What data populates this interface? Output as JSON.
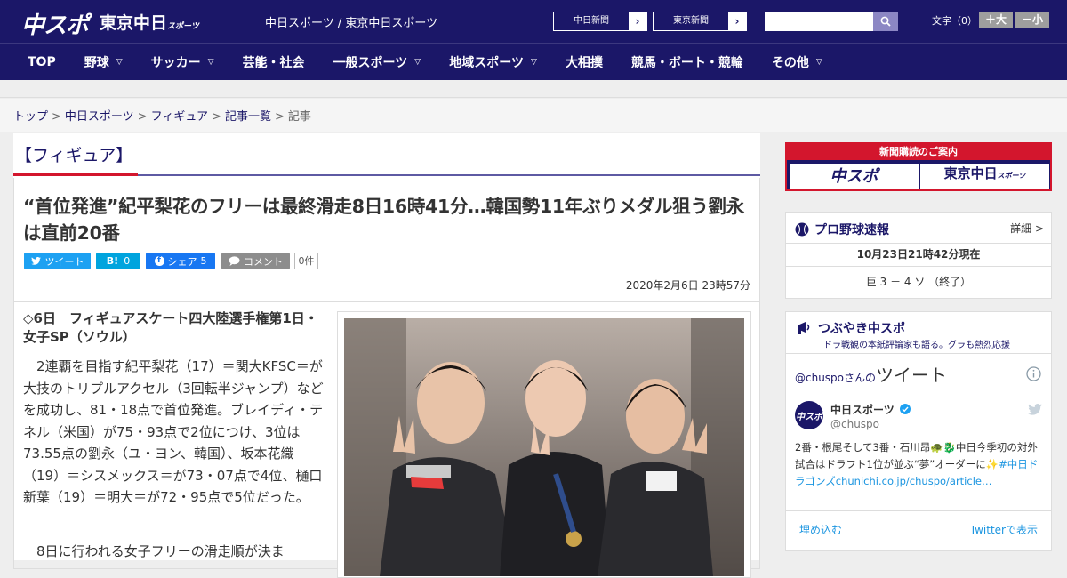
{
  "header": {
    "logo_main": "中スポ",
    "logo_tokyo": "東京中日",
    "logo_tokyo_sub": "スポーツ",
    "site_names": "中日スポーツ / 東京中日スポーツ",
    "paper_links": [
      "中日新聞",
      "東京新聞"
    ],
    "search": {
      "placeholder": ""
    },
    "font_size_label": "文字（0）",
    "font_bigger": "＋大",
    "font_smaller": "－小"
  },
  "nav": {
    "items": [
      {
        "label": "TOP",
        "has_menu": false
      },
      {
        "label": "野球",
        "has_menu": true
      },
      {
        "label": "サッカー",
        "has_menu": true
      },
      {
        "label": "芸能・社会",
        "has_menu": false
      },
      {
        "label": "一般スポーツ",
        "has_menu": true
      },
      {
        "label": "地域スポーツ",
        "has_menu": true
      },
      {
        "label": "大相撲",
        "has_menu": false
      },
      {
        "label": "競馬・ボート・競輪",
        "has_menu": false
      },
      {
        "label": "その他",
        "has_menu": true
      }
    ]
  },
  "breadcrumb": {
    "items": [
      "トップ",
      "中日スポーツ",
      "フィギュア",
      "記事一覧"
    ],
    "current": "記事",
    "separator": ">"
  },
  "article": {
    "category": "【フィギュア】",
    "headline": "“首位発進”紀平梨花のフリーは最終滑走8日16時41分…韓国勢11年ぶりメダル狙う劉永は直前20番",
    "share": {
      "tweet": "ツイート",
      "hatena_label": "B!",
      "hatena_count": "0",
      "facebook": "シェア",
      "facebook_count": "5",
      "comment": "コメント",
      "comment_count": "0件"
    },
    "date": "2020年2月6日 23時57分",
    "event": "◇6日　フィギュアスケート四大陸選手権第1日・女子SP（ソウル）",
    "paragraphs": [
      "2連覇を目指す紀平梨花（17）＝関大KFSC＝が大技のトリプルアクセル（3回転半ジャンプ）などを成功し、81・18点で首位発進。ブレイディ・テネル（米国）が75・93点で2位につけ、3位は73.55点の劉永（ユ・ヨン、韓国）、坂本花織（19）＝シスメックス＝が73・07点で4位、樋口新葉（19）＝明大＝が72・95点で5位だった。",
      "8日に行われる女子フリーの滑走順が決ま"
    ]
  },
  "sidebar": {
    "subscribe": {
      "title": "新聞購読のご案内",
      "logo_left": "中スポ",
      "logo_right": "東京中日",
      "logo_right_sub": "スポーツ"
    },
    "baseball": {
      "title": "プロ野球速報",
      "more": "詳細 >",
      "time": "10月23日21時42分現在",
      "score": "巨 3 － 4 ソ （終了）"
    },
    "twitter": {
      "title": "つぶやき中スポ",
      "subtitle": "ドラ戦観の本紙評論家も語る。グラも熱烈応援",
      "handle_link": "@chuspo",
      "handle_suffix": "さんの",
      "tweets_word": "ツイート",
      "account_name": "中日スポーツ",
      "account_handle": "@chuspo",
      "avatar_text": "中スポ",
      "tweet_text": "2番・根尾そして3番・石川昂🐢🐉中日今季初の対外試合はドラフト1位が並ぶ“夢”オーダーに✨",
      "tweet_link": "#中日ドラゴンズchunichi.co.jp/chuspo/article…",
      "embed": "埋め込む",
      "view_on": "Twitterで表示"
    }
  },
  "colors": {
    "brand_navy": "#1b1768",
    "accent_red": "#d3162d",
    "twitter": "#1da1f2",
    "hatena": "#00a4de",
    "facebook": "#1877f2"
  }
}
